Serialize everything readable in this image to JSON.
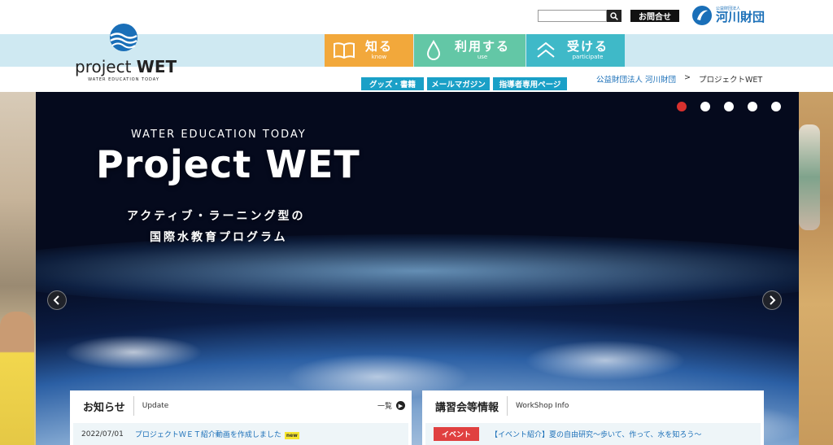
{
  "header": {
    "search_placeholder": "",
    "contact_label": "お問合せ",
    "foundation_small": "公益財団法人",
    "foundation_name": "河川財団"
  },
  "logo": {
    "name_plain": "project",
    "name_bold": "WET",
    "tagline": "WATER EDUCATION TODAY"
  },
  "nav": [
    {
      "jp": "知る",
      "en": "know",
      "icon": "book-icon",
      "color": "#f2a83b"
    },
    {
      "jp": "利用する",
      "en": "use",
      "icon": "droplet-icon",
      "color": "#63c7a6"
    },
    {
      "jp": "受ける",
      "en": "participate",
      "icon": "chevron-up-icon",
      "color": "#3fb9c8"
    }
  ],
  "subnav": [
    "グッズ・書籍",
    "メールマガジン",
    "指導者専用ページ"
  ],
  "breadcrumb": {
    "link": "公益財団法人 河川財団",
    "sep": ">",
    "current": "プロジェクトWET"
  },
  "hero": {
    "eyebrow": "WATER EDUCATION TODAY",
    "title": "Project WET",
    "sub_line1": "アクティブ・ラーニング型の",
    "sub_line2": "国際水教育プログラム"
  },
  "news": {
    "title_jp": "お知らせ",
    "title_en": "Update",
    "more_label": "一覧",
    "items": [
      {
        "date": "2022/07/01",
        "title": "プロジェクトＷＥＴ紹介動画を作成しました",
        "badge": "new"
      }
    ]
  },
  "workshop": {
    "title_jp": "講習会等情報",
    "title_en": "WorkShop Info",
    "items": [
      {
        "tag": "イベント",
        "title": "【イベント紹介】夏の自由研究～歩いて、作って、水を知ろう～"
      }
    ]
  }
}
